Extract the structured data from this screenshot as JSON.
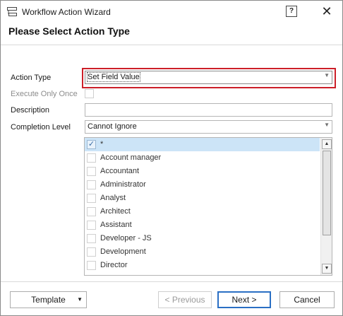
{
  "window": {
    "title": "Workflow Action Wizard",
    "help_label": "?",
    "close_label": "✕"
  },
  "heading": "Please Select Action Type",
  "form": {
    "action_type_label": "Action Type",
    "action_type_value": "Set Field Value",
    "execute_once_label": "Execute Only Once",
    "description_label": "Description",
    "description_value": "",
    "completion_level_label": "Completion Level",
    "completion_level_value": "Cannot Ignore"
  },
  "roles": {
    "items": [
      {
        "label": "*",
        "checked": true
      },
      {
        "label": "Account manager",
        "checked": false
      },
      {
        "label": "Accountant",
        "checked": false
      },
      {
        "label": "Administrator",
        "checked": false
      },
      {
        "label": "Analyst",
        "checked": false
      },
      {
        "label": "Architect",
        "checked": false
      },
      {
        "label": "Assistant",
        "checked": false
      },
      {
        "label": "Developer - JS",
        "checked": false
      },
      {
        "label": "Development",
        "checked": false
      },
      {
        "label": "Director",
        "checked": false
      }
    ]
  },
  "buttons": {
    "template": "Template",
    "previous": "< Previous",
    "next": "Next >",
    "cancel": "Cancel"
  },
  "colors": {
    "highlight": "#cc1f28",
    "selected_row": "#cce4f7",
    "primary_border": "#2a6fc4"
  }
}
